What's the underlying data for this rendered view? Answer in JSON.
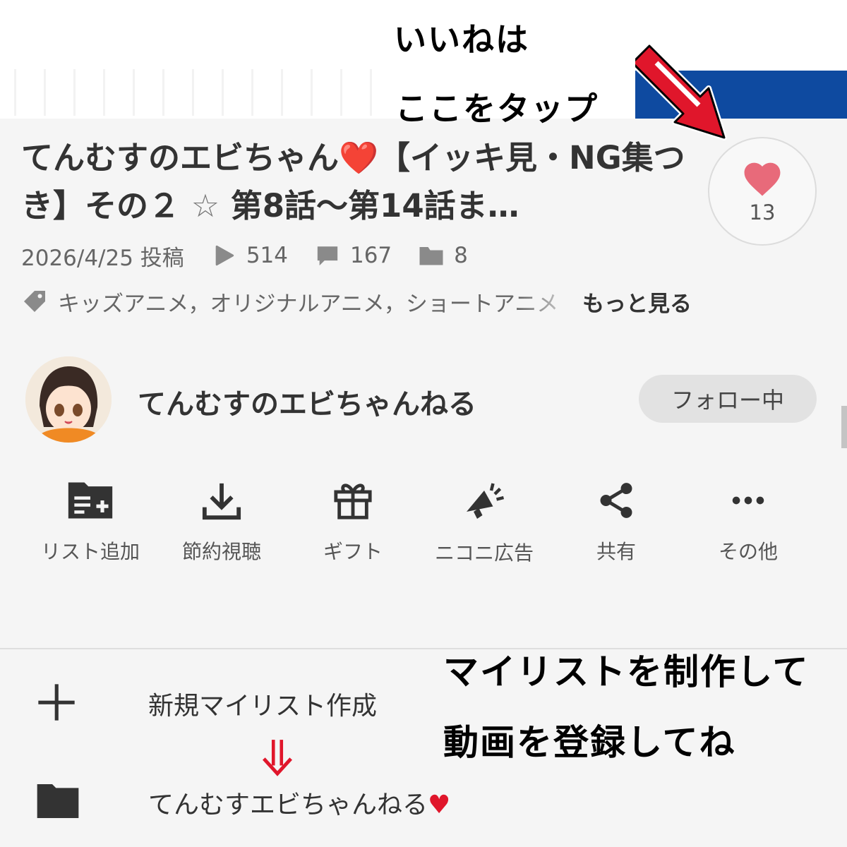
{
  "annotations": {
    "like_line1": "いいねは",
    "like_line2": "ここをタップ",
    "mylist_line1": "マイリストを制作して",
    "mylist_line2": "動画を登録してね"
  },
  "video": {
    "title_part1": "てんむすのエビちゃん",
    "title_heart": "❤️",
    "title_part2": "【イッキ見・NG集つき】その２",
    "title_star": "☆",
    "title_part3": "第8話〜第14話ま…",
    "like_count": "13",
    "posted": "2026/4/25 投稿",
    "views": "514",
    "comments": "167",
    "mylists": "8",
    "tags": "キッズアニメ，オリジナルアニメ，ショートアニメ",
    "more_label": "もっと見る"
  },
  "channel": {
    "name": "てんむすのエビちゃんねる",
    "follow_label": "フォロー中"
  },
  "actions": [
    {
      "label": "リスト追加",
      "icon": "folder-add-icon"
    },
    {
      "label": "節約視聴",
      "icon": "download-icon"
    },
    {
      "label": "ギフト",
      "icon": "gift-icon"
    },
    {
      "label": "ニコニ広告",
      "icon": "megaphone-icon"
    },
    {
      "label": "共有",
      "icon": "share-icon"
    },
    {
      "label": "その他",
      "icon": "more-icon"
    }
  ],
  "mylist": {
    "new_label": "新規マイリスト作成",
    "item_label": "てんむすエビちゃんねる",
    "item_heart": "♥"
  },
  "colors": {
    "accent_red": "#e0162b",
    "like_heart": "#e86a7a",
    "brand_blue": "#0e4aa0"
  }
}
